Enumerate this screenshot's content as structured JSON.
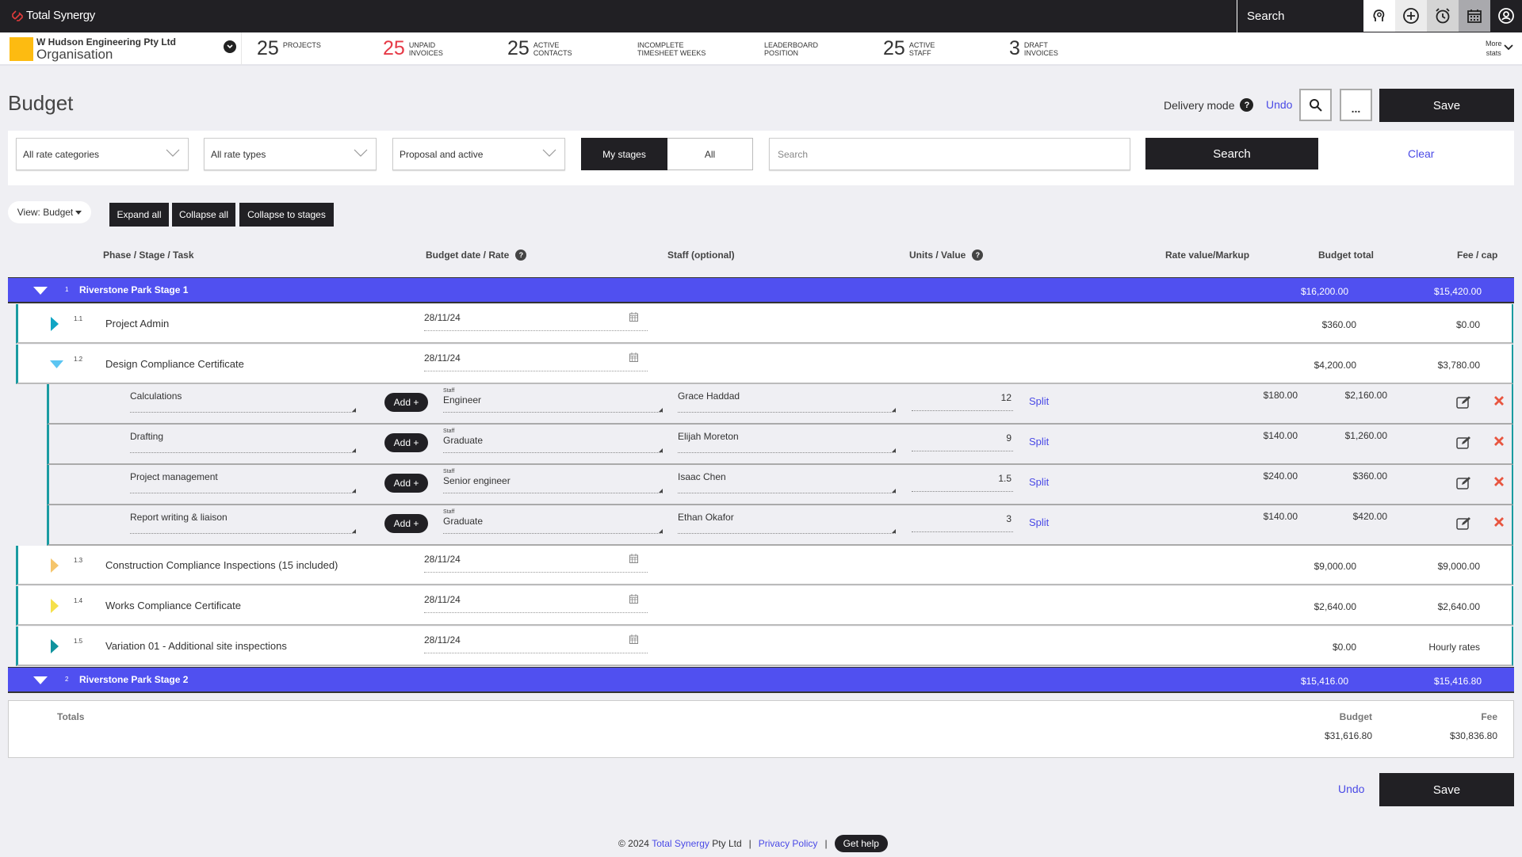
{
  "app": {
    "name": "Total Synergy",
    "search_placeholder": "Search",
    "top_icons": [
      "insights-head-icon",
      "add-circle-icon",
      "alarm-clock-icon",
      "calendar-icon",
      "user-profile-icon"
    ]
  },
  "org": {
    "name": "W Hudson Engineering Pty Ltd",
    "sub": "Organisation",
    "swatch_color": "#fdbb11"
  },
  "stats": [
    {
      "value": "25",
      "label1": "PROJECTS",
      "label2": ""
    },
    {
      "value": "25",
      "label1": "UNPAID",
      "label2": "INVOICES",
      "color": "#e63946"
    },
    {
      "value": "25",
      "label1": "ACTIVE",
      "label2": "CONTACTS"
    },
    {
      "value": "",
      "label1": "INCOMPLETE",
      "label2": "TIMESHEET WEEKS"
    },
    {
      "value": "",
      "label1": "LEADERBOARD",
      "label2": "POSITION"
    },
    {
      "value": "25",
      "label1": "ACTIVE",
      "label2": "STAFF"
    },
    {
      "value": "3",
      "label1": "DRAFT",
      "label2": "INVOICES"
    }
  ],
  "more_stats": {
    "line1": "More",
    "line2": "stats"
  },
  "page": {
    "title": "Budget",
    "delivery_mode_label": "Delivery mode",
    "undo_label": "Undo",
    "more_label": "...",
    "save_label": "Save"
  },
  "filters": {
    "rate_categories": "All rate categories",
    "rate_types": "All rate types",
    "status": "Proposal and active",
    "segment": [
      {
        "label": "My stages",
        "active": true
      },
      {
        "label": "All",
        "active": false
      }
    ],
    "search_placeholder": "Search",
    "search_button": "Search",
    "clear_label": "Clear"
  },
  "view_controls": {
    "view_label": "View: Budget",
    "expand_all": "Expand all",
    "collapse_all": "Collapse all",
    "collapse_to_stages": "Collapse to stages"
  },
  "columns": {
    "phase": "Phase / Stage / Task",
    "budget_date": "Budget date / Rate",
    "staff": "Staff (optional)",
    "units": "Units / Value",
    "rate_value": "Rate value/Markup",
    "budget_total": "Budget total",
    "fee_cap": "Fee / cap"
  },
  "stages": [
    {
      "num": "1",
      "name": "Riverstone Park Stage 1",
      "budget_total": "$16,200.00",
      "fee_cap": "$15,420.00",
      "expanded": true,
      "tasks": [
        {
          "num": "1.1",
          "name": "Project Admin",
          "date": "28/11/24",
          "budget_total": "$360.00",
          "fee_cap": "$0.00",
          "status_color": "#10a5c4",
          "expanded": false
        },
        {
          "num": "1.2",
          "name": "Design Compliance Certificate",
          "date": "28/11/24",
          "budget_total": "$4,200.00",
          "fee_cap": "$3,780.00",
          "status_color": "#5bc5f2",
          "expanded": true,
          "items": [
            {
              "task": "Calculations",
              "add_label": "Add +",
              "staff_tag": "Staff",
              "role": "Engineer",
              "staff": "Grace Haddad",
              "units": "12",
              "split_label": "Split",
              "rate": "$180.00",
              "total": "$2,160.00"
            },
            {
              "task": "Drafting",
              "add_label": "Add +",
              "staff_tag": "Staff",
              "role": "Graduate",
              "staff": "Elijah Moreton",
              "units": "9",
              "split_label": "Split",
              "rate": "$140.00",
              "total": "$1,260.00"
            },
            {
              "task": "Project management",
              "add_label": "Add +",
              "staff_tag": "Staff",
              "role": "Senior engineer",
              "staff": "Isaac Chen",
              "units": "1.5",
              "split_label": "Split",
              "rate": "$240.00",
              "total": "$360.00"
            },
            {
              "task": "Report writing & liaison",
              "add_label": "Add +",
              "staff_tag": "Staff",
              "role": "Graduate",
              "staff": "Ethan Okafor",
              "units": "3",
              "split_label": "Split",
              "rate": "$140.00",
              "total": "$420.00"
            }
          ]
        },
        {
          "num": "1.3",
          "name": "Construction Compliance Inspections (15 included)",
          "date": "28/11/24",
          "budget_total": "$9,000.00",
          "fee_cap": "$9,000.00",
          "status_color": "#f5c56b",
          "expanded": false
        },
        {
          "num": "1.4",
          "name": "Works Compliance Certificate",
          "date": "28/11/24",
          "budget_total": "$2,640.00",
          "fee_cap": "$2,640.00",
          "status_color": "#f5e04a",
          "expanded": false
        },
        {
          "num": "1.5",
          "name": "Variation 01 - Additional site inspections",
          "date": "28/11/24",
          "budget_total": "$0.00",
          "fee_cap": "Hourly rates",
          "status_color": "#10939e",
          "expanded": false
        }
      ]
    },
    {
      "num": "2",
      "name": "Riverstone Park Stage 2",
      "budget_total": "$15,416.00",
      "fee_cap": "$15,416.80",
      "expanded": true
    }
  ],
  "totals": {
    "label": "Totals",
    "budget_label": "Budget",
    "fee_label": "Fee",
    "budget": "$31,616.80",
    "fee": "$30,836.80"
  },
  "bottom": {
    "undo_label": "Undo",
    "save_label": "Save"
  },
  "footer": {
    "copyright": "© 2024",
    "company_link": "Total Synergy",
    "company_suffix": "Pty Ltd",
    "privacy": "Privacy Policy",
    "help": "Get help"
  },
  "colors": {
    "stage_bg": "#5050f0",
    "task_border": "#1a9ba1",
    "link": "#4a4ae6",
    "delete": "#e8553f",
    "dark": "#212024"
  }
}
